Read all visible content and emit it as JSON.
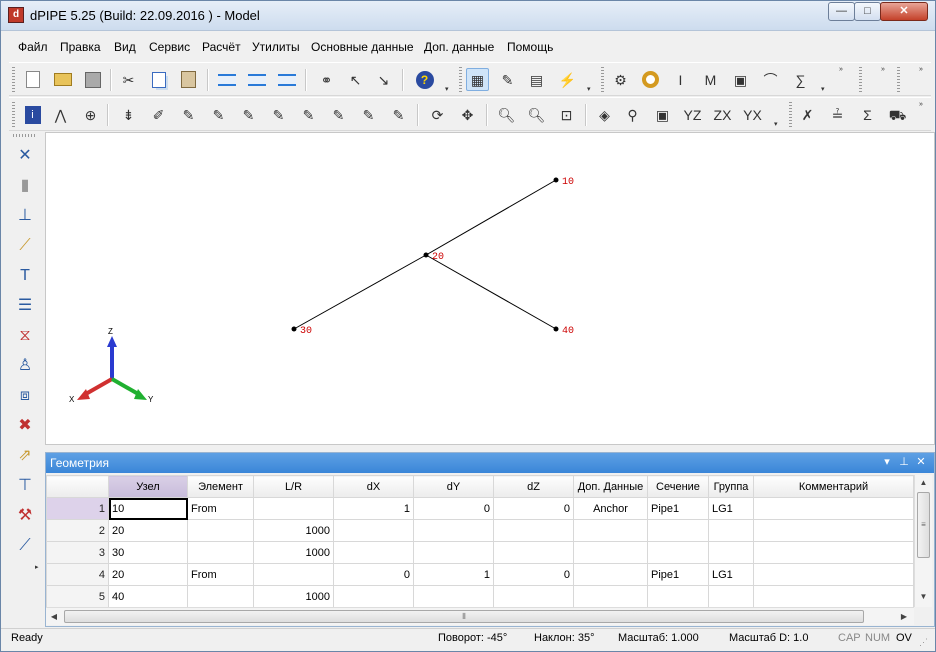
{
  "window": {
    "title": "dPIPE 5.25 (Build: 22.09.2016 ) - Model",
    "controls": {
      "minimize": "—",
      "maximize": "□",
      "close": "✕"
    }
  },
  "menu": [
    "Файл",
    "Правка",
    "Вид",
    "Сервис",
    "Расчёт",
    "Утилиты",
    "Основные данные",
    "Доп. данные",
    "Помощь"
  ],
  "viewport": {
    "nodes": [
      {
        "label": "10"
      },
      {
        "label": "20"
      },
      {
        "label": "30"
      },
      {
        "label": "40"
      }
    ],
    "triad": {
      "z": "Z",
      "x": "X",
      "y": "Y"
    },
    "colors": {
      "node_label": "#cc0000",
      "line": "#000000",
      "z_axis": "#2a3ad0",
      "x_axis": "#d03030",
      "y_axis": "#20b030"
    }
  },
  "geometry": {
    "title": "Геометрия",
    "columns": [
      "Узел",
      "Элемент",
      "L/R",
      "dX",
      "dY",
      "dZ",
      "Доп. Данные",
      "Сечение",
      "Группа",
      "Комментарий"
    ],
    "rows": [
      {
        "n": "1",
        "cells": [
          "10",
          "From",
          "",
          "1",
          "0",
          "0",
          "Anchor",
          "Pipe1",
          "LG1",
          ""
        ]
      },
      {
        "n": "2",
        "cells": [
          "20",
          "",
          "1000",
          "",
          "",
          "",
          "",
          "",
          "",
          ""
        ]
      },
      {
        "n": "3",
        "cells": [
          "30",
          "",
          "1000",
          "",
          "",
          "",
          "",
          "",
          "",
          ""
        ]
      },
      {
        "n": "4",
        "cells": [
          "20",
          "From",
          "",
          "0",
          "1",
          "0",
          "",
          "Pipe1",
          "LG1",
          ""
        ]
      },
      {
        "n": "5",
        "cells": [
          "40",
          "",
          "1000",
          "",
          "",
          "",
          "",
          "",
          "",
          ""
        ]
      }
    ]
  },
  "status": {
    "ready": "Ready",
    "rotation": "Поворот: -45°",
    "tilt": "Наклон: 35°",
    "scale": "Масштаб: 1.000",
    "scale_d": "Масштаб D: 1.0",
    "cap": "CAP",
    "num": "NUM",
    "ov": "OV"
  }
}
